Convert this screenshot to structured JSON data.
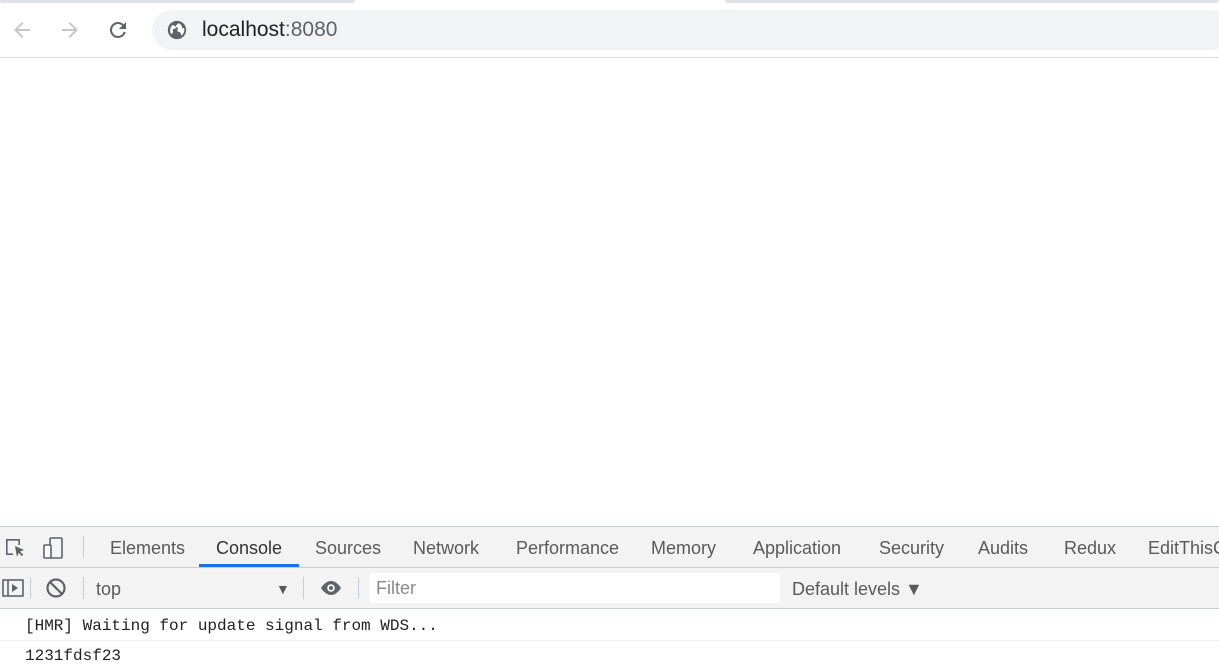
{
  "browser": {
    "url_host": "localhost",
    "url_port": ":8080",
    "icons": {
      "back": "arrow-left-icon",
      "forward": "arrow-right-icon",
      "reload": "reload-icon",
      "site_info": "globe-icon"
    }
  },
  "devtools": {
    "tabs": [
      {
        "label": "Elements",
        "active": false
      },
      {
        "label": "Console",
        "active": true
      },
      {
        "label": "Sources",
        "active": false
      },
      {
        "label": "Network",
        "active": false
      },
      {
        "label": "Performance",
        "active": false
      },
      {
        "label": "Memory",
        "active": false
      },
      {
        "label": "Application",
        "active": false
      },
      {
        "label": "Security",
        "active": false
      },
      {
        "label": "Audits",
        "active": false
      },
      {
        "label": "Redux",
        "active": false
      },
      {
        "label": "EditThisCookie",
        "active": false
      }
    ],
    "accent_color": "#1a73e8",
    "console_toolbar": {
      "context": "top",
      "filter_placeholder": "Filter",
      "levels": "Default levels ▼"
    },
    "console_messages": [
      "[HMR] Waiting for update signal from WDS...",
      "1231fdsf23"
    ]
  }
}
